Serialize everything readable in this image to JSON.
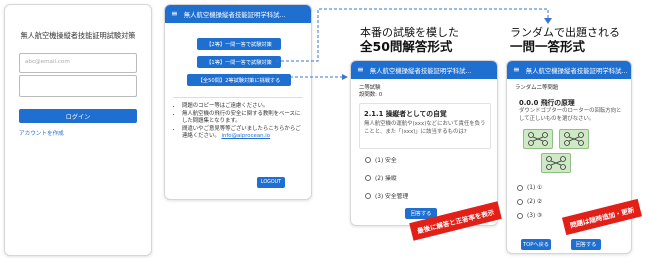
{
  "login_screen": {
    "title": "無人航空機操縦者技能証明試験対策",
    "email_placeholder": "abc@email.com",
    "password_placeholder": "",
    "login_button": "ログイン",
    "create_account_link": "アカウントを作成"
  },
  "menu_screen": {
    "appbar_title": "無人航空機操縦者技能証明学科試...",
    "buttons": [
      "【2等】一問一答で試験対策",
      "【1等】一問一答で試験対策",
      "【全50問】2等試験対策に挑戦する"
    ],
    "notes": [
      "問題のコピー等はご遠慮ください。",
      "無人航空機の飛行の安全に関する教則をベースにした問題集となります。",
      "間違いやご意見等等ございましたらこちらからご連絡ください。"
    ],
    "email": "info@aiprocean.io",
    "logout_button": "LOGOUT"
  },
  "exam_screen": {
    "caption_line1": "本番の試験を模した",
    "caption_line2": "全50問解答形式",
    "appbar_title": "無人航空機操縦者技能証明学科試...",
    "exam_label": "二等試験",
    "question_count": "設問数: 0",
    "question_title": "2.1.1 操縦者としての自覚",
    "question_text": "無人航空機の運航や(xxx)などにおいて責任を負うことと、また「(xxx)」に該当するものは?",
    "options": [
      "(1) 安全",
      "(2) 操縦",
      "(3) 安全管理"
    ],
    "answer_button": "回答する",
    "banner": "最後に解答と正答率を表示"
  },
  "quiz_screen": {
    "caption_line1": "ランダムで出題される",
    "caption_line2": "一問一答形式",
    "appbar_title": "無人航空機操縦者技能証明学科試...",
    "exam_label": "ランダム二等問題",
    "question_title": "0.0.0 飛行の原理",
    "question_text": "ダウンドゴブターのローターの回転方向として正しいものを選びなさい。",
    "options": [
      "(1) ①",
      "(2) ②",
      "(3) ③"
    ],
    "top_button": "TOPへ戻る",
    "answer_button": "回答する",
    "banner": "問題は随時追加・更新"
  },
  "colors": {
    "primary": "#1f6fd1",
    "accent_red": "#e32018",
    "card_green": "#cfe9c7"
  }
}
